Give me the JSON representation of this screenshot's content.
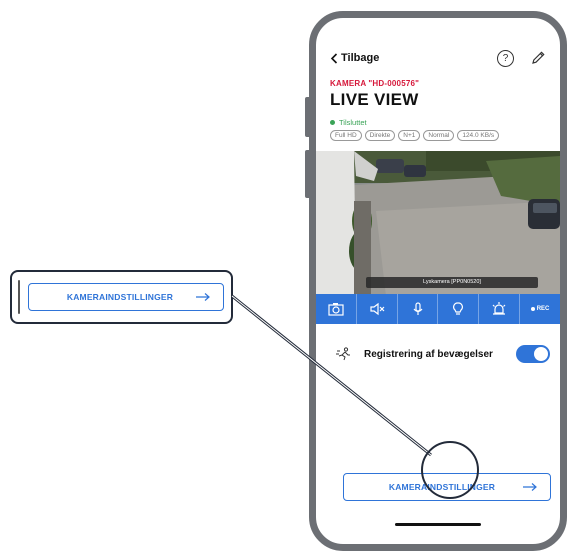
{
  "header": {
    "back_label": "Tilbage",
    "help_glyph": "?"
  },
  "camera": {
    "name_line": "KAMERA \"HD-000576\"",
    "title": "LIVE VIEW",
    "status": "Tilsluttet",
    "chips": [
      "Full HD",
      "Direkte",
      "N+1",
      "Normal",
      "124.0 KB/s"
    ],
    "video_caption": "Lyskamera [PP0N0520]"
  },
  "controls": {
    "items": [
      "snapshot-icon",
      "speaker-icon",
      "microphone-icon",
      "light-icon",
      "siren-icon"
    ],
    "rec_label": "REC"
  },
  "motion": {
    "label": "Registrering af bevægelser",
    "enabled": true
  },
  "settings_button": {
    "label": "KAMERAINDSTILLINGER"
  },
  "callout": {
    "label": "KAMERAINDSTILLINGER"
  },
  "colors": {
    "accent": "#2f74d8",
    "brand_red": "#d6173a",
    "status_green": "#3aa357",
    "frame": "#6c6f74",
    "callout_border": "#232b3a"
  }
}
